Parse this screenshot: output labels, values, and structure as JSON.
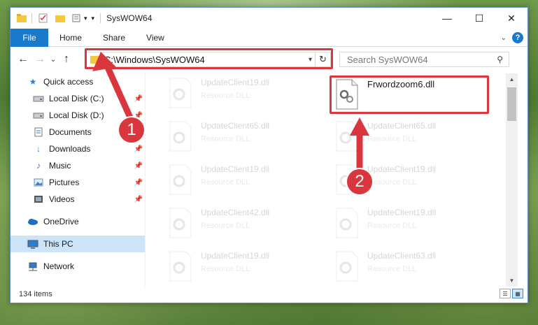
{
  "window": {
    "title": "SysWOW64",
    "controls": {
      "minimize": "—",
      "maximize": "☐",
      "close": "✕"
    }
  },
  "ribbon": {
    "tabs": [
      "File",
      "Home",
      "Share",
      "View"
    ],
    "help": "?"
  },
  "nav": {
    "back": "←",
    "forward": "→",
    "recent": "⌄",
    "up": "↑",
    "address": "C:\\Windows\\SysWOW64",
    "refresh": "↻",
    "search_placeholder": "Search SysWOW64"
  },
  "sidebar": {
    "items": [
      {
        "label": "Quick access",
        "icon": "star-icon",
        "pinned": false
      },
      {
        "label": "Local Disk (C:)",
        "icon": "drive-icon",
        "pinned": true
      },
      {
        "label": "Local Disk (D:)",
        "icon": "drive-icon",
        "pinned": true
      },
      {
        "label": "Documents",
        "icon": "documents-icon",
        "pinned": true
      },
      {
        "label": "Downloads",
        "icon": "download-icon",
        "pinned": true
      },
      {
        "label": "Music",
        "icon": "music-icon",
        "pinned": true
      },
      {
        "label": "Pictures",
        "icon": "pictures-icon",
        "pinned": true
      },
      {
        "label": "Videos",
        "icon": "videos-icon",
        "pinned": true
      },
      {
        "label": "OneDrive",
        "icon": "cloud-icon",
        "pinned": false
      },
      {
        "label": "This PC",
        "icon": "pc-icon",
        "pinned": false,
        "selected": true
      },
      {
        "label": "Network",
        "icon": "network-icon",
        "pinned": false
      }
    ]
  },
  "files": {
    "left_column": [
      {
        "name": "UpdateClient19.dll",
        "type": "Resource DLL"
      },
      {
        "name": "UpdateClient65.dll",
        "type": "Resource DLL"
      },
      {
        "name": "UpdateClient19.dll",
        "type": "Resource DLL"
      },
      {
        "name": "UpdateClient42.dll",
        "type": "Resource DLL"
      },
      {
        "name": "UpdateClient19.dll",
        "type": "Resource DLL"
      }
    ],
    "right_column": [
      {
        "name": "Frwordzoom6.dll",
        "type": ""
      },
      {
        "name": "UpdateClient65.dll",
        "type": "Resource DLL"
      },
      {
        "name": "UpdateClient19.dll",
        "type": "Resource DLL"
      },
      {
        "name": "UpdateClient19.dll",
        "type": "Resource DLL"
      },
      {
        "name": "UpdateClient63.dll",
        "type": "Resource DLL"
      }
    ]
  },
  "status": {
    "item_count": "134 items"
  },
  "annotations": {
    "marker1": "1",
    "marker2": "2",
    "color": "#d9363e"
  }
}
